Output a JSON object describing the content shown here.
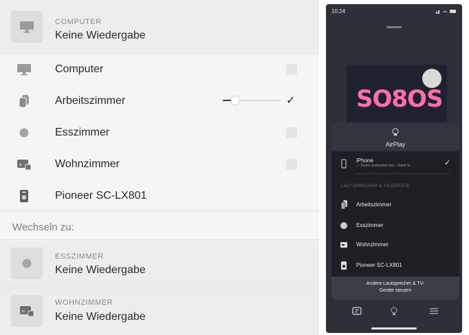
{
  "now_playing": {
    "device_type": "COMPUTER",
    "status": "Keine Wiedergabe"
  },
  "devices": [
    {
      "label": "Computer",
      "icon": "monitor-icon",
      "selected": false
    },
    {
      "label": "Arbeitszimmer",
      "icon": "speaker-group-icon",
      "selected": true,
      "volume": 0.22
    },
    {
      "label": "Esszimmer",
      "icon": "homepod-icon",
      "selected": false
    },
    {
      "label": "Wohnzimmer",
      "icon": "apple-tv-icon",
      "selected": false
    },
    {
      "label": "Pioneer SC-LX801",
      "icon": "receiver-icon",
      "selected": null
    }
  ],
  "switch_to": {
    "label": "Wechseln zu:",
    "targets": [
      {
        "device_type": "ESSZIMMER",
        "status": "Keine Wiedergabe",
        "icon": "homepod-icon"
      },
      {
        "device_type": "WOHNZIMMER",
        "status": "Keine Wiedergabe",
        "icon": "apple-tv-icon"
      }
    ]
  },
  "phone": {
    "time": "10:24",
    "album_text": "SO8OS",
    "airplay_title": "AirPlay",
    "iphone": {
      "label": "iPhone",
      "subtitle": "— Desire (extended mix) – Remi Sr...",
      "checkmark": "✓"
    },
    "section_label": "LAUTSPRECHER & TV-GERÄTE",
    "speakers": [
      "Arbeitszimmer",
      "Esszimmer",
      "Wohnzimmer",
      "Pioneer SC-LX801"
    ],
    "control_button": [
      "Andere Lautsprecher & TV-",
      "Geräte steuern"
    ]
  },
  "colors": {
    "panel_bg": "#f5f5f5",
    "card_bg": "#ededed",
    "phone_bg": "#2d3039",
    "accent_text": "#262626"
  }
}
